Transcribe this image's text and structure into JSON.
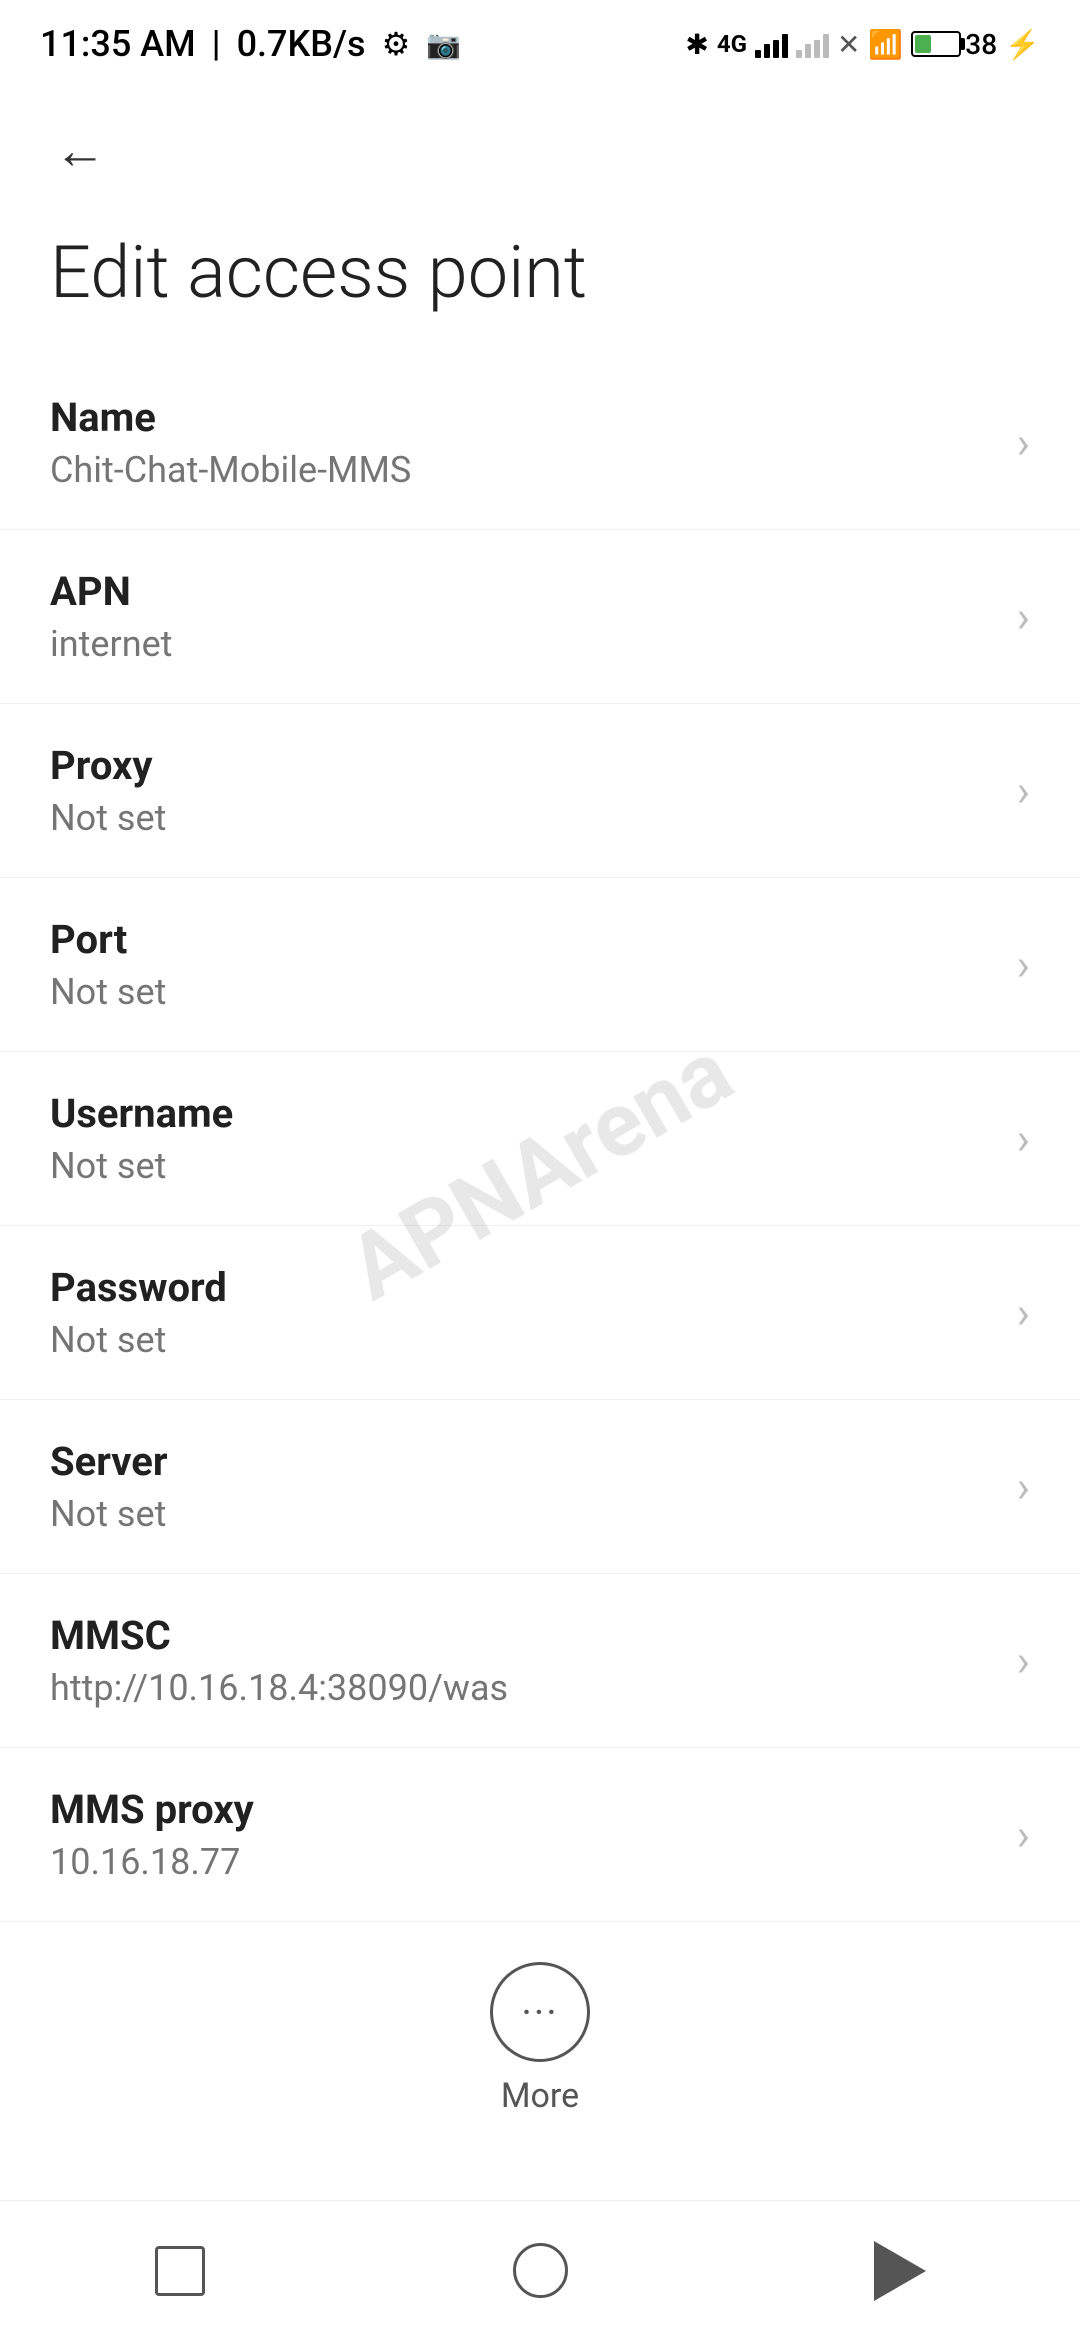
{
  "statusBar": {
    "time": "11:35 AM",
    "network": "0.7KB/s",
    "batteryPercent": "38"
  },
  "toolbar": {
    "back_label": "←"
  },
  "page": {
    "title": "Edit access point"
  },
  "settings": {
    "items": [
      {
        "label": "Name",
        "value": "Chit-Chat-Mobile-MMS"
      },
      {
        "label": "APN",
        "value": "internet"
      },
      {
        "label": "Proxy",
        "value": "Not set"
      },
      {
        "label": "Port",
        "value": "Not set"
      },
      {
        "label": "Username",
        "value": "Not set"
      },
      {
        "label": "Password",
        "value": "Not set"
      },
      {
        "label": "Server",
        "value": "Not set"
      },
      {
        "label": "MMSC",
        "value": "http://10.16.18.4:38090/was"
      },
      {
        "label": "MMS proxy",
        "value": "10.16.18.77"
      }
    ]
  },
  "more": {
    "label": "More"
  },
  "watermark": {
    "text": "APNArena"
  }
}
